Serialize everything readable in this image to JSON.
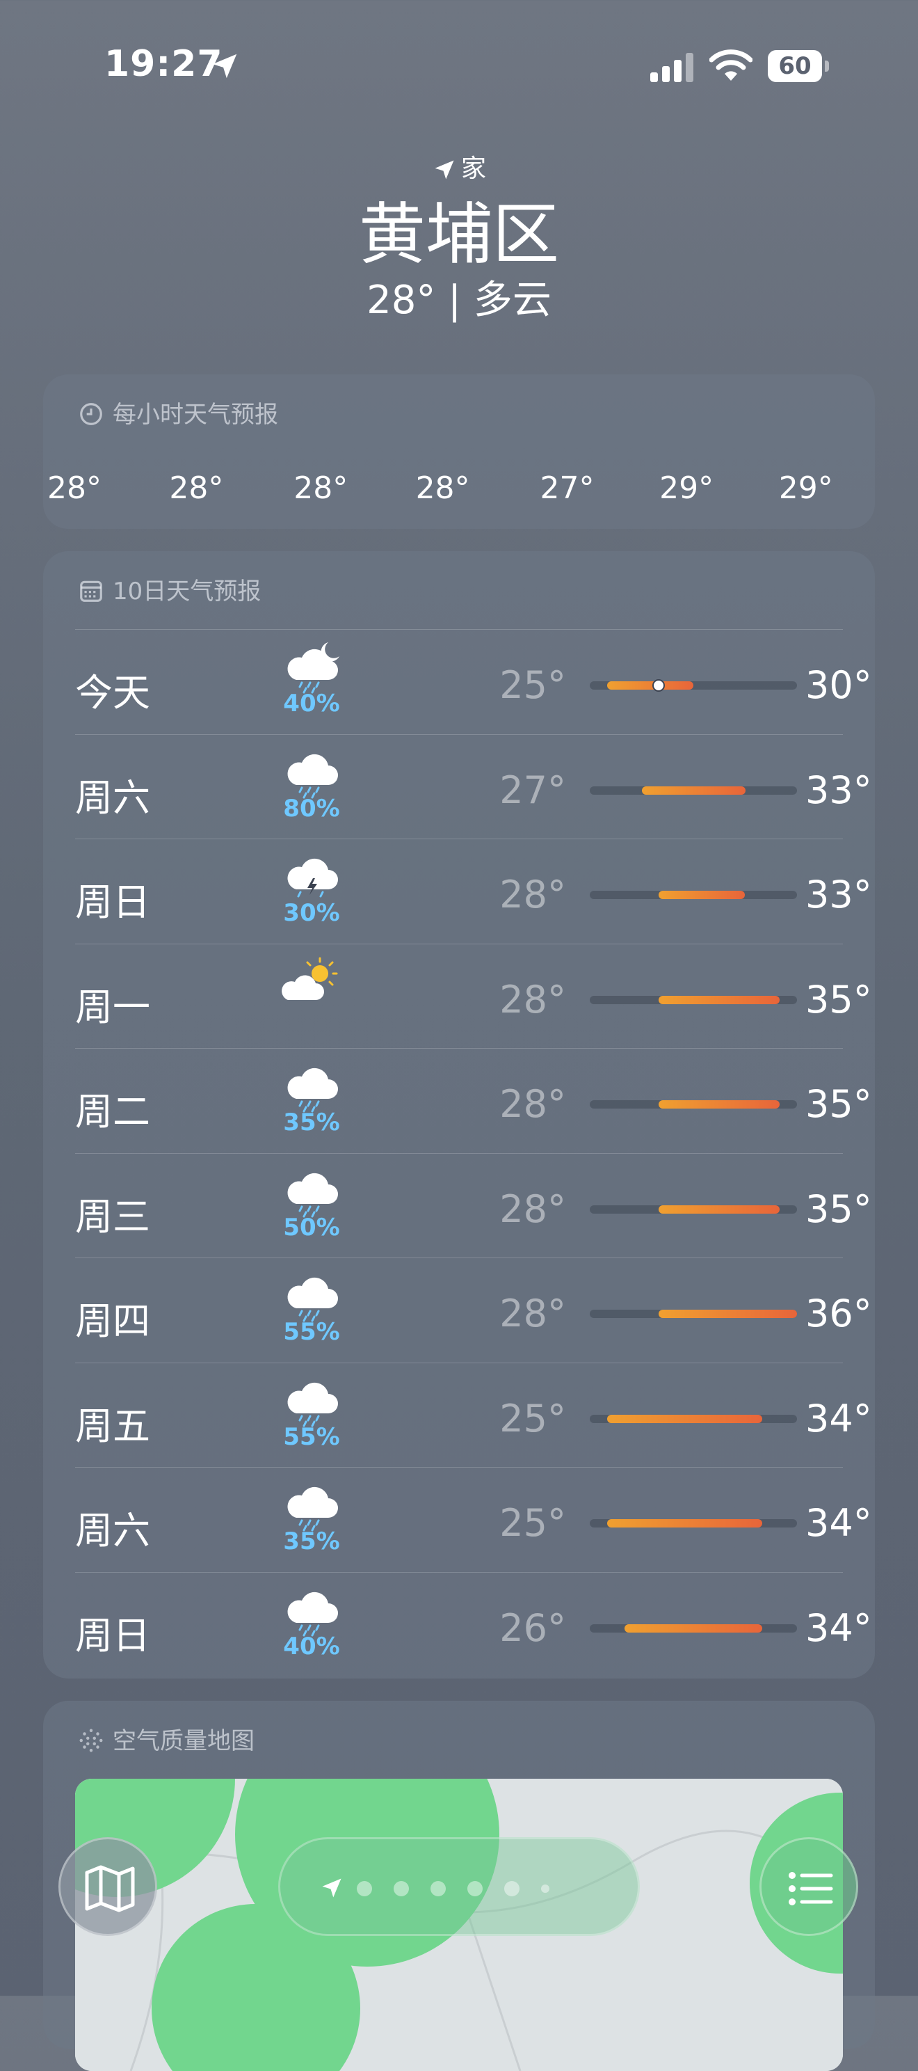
{
  "status_bar": {
    "time": "19:27",
    "battery": "60"
  },
  "location": {
    "label": "家",
    "city": "黄埔区",
    "summary": "28° | 多云"
  },
  "hourly": {
    "title": "每小时天气预报",
    "temps": [
      "28°",
      "28°",
      "28°",
      "28°",
      "27°",
      "29°",
      "29°"
    ]
  },
  "daily": {
    "title": "10日天气预报",
    "days": [
      {
        "day": "今天",
        "icon": "cloud-moon-rain-icon",
        "precip": "40%",
        "low": "25°",
        "high": "30°",
        "low_value": 25,
        "high_value": 30,
        "current": 28
      },
      {
        "day": "周六",
        "icon": "cloud-rain-icon",
        "precip": "80%",
        "low": "27°",
        "high": "33°",
        "low_value": 27,
        "high_value": 33
      },
      {
        "day": "周日",
        "icon": "cloud-bolt-rain-icon",
        "precip": "30%",
        "low": "28°",
        "high": "33°",
        "low_value": 28,
        "high_value": 33
      },
      {
        "day": "周一",
        "icon": "cloud-sun-icon",
        "precip": "",
        "low": "28°",
        "high": "35°",
        "low_value": 28,
        "high_value": 35
      },
      {
        "day": "周二",
        "icon": "cloud-rain-icon",
        "precip": "35%",
        "low": "28°",
        "high": "35°",
        "low_value": 28,
        "high_value": 35
      },
      {
        "day": "周三",
        "icon": "cloud-rain-icon",
        "precip": "50%",
        "low": "28°",
        "high": "35°",
        "low_value": 28,
        "high_value": 35
      },
      {
        "day": "周四",
        "icon": "cloud-rain-icon",
        "precip": "55%",
        "low": "28°",
        "high": "36°",
        "low_value": 28,
        "high_value": 36
      },
      {
        "day": "周五",
        "icon": "cloud-rain-icon",
        "precip": "55%",
        "low": "25°",
        "high": "34°",
        "low_value": 25,
        "high_value": 34
      },
      {
        "day": "周六",
        "icon": "cloud-rain-icon",
        "precip": "35%",
        "low": "25°",
        "high": "34°",
        "low_value": 25,
        "high_value": 34
      },
      {
        "day": "周日",
        "icon": "cloud-rain-icon",
        "precip": "40%",
        "low": "26°",
        "high": "34°",
        "low_value": 26,
        "high_value": 34
      }
    ],
    "range_min": 24,
    "range_max": 36
  },
  "air_quality": {
    "title": "空气质量地图"
  },
  "bottom_bar": {
    "page_count": 7,
    "active_page": 0
  },
  "colors": {
    "precip": "#6fc8ff",
    "bar_warm": "#f0a030",
    "bar_hot": "#e8653a"
  }
}
